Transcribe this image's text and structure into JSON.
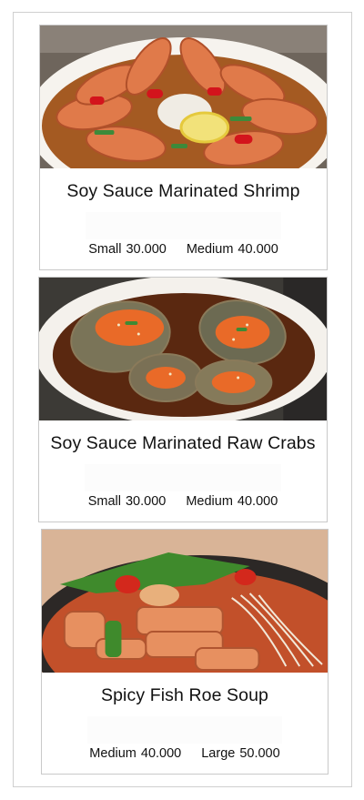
{
  "menu": {
    "items": [
      {
        "title": "Soy Sauce Marinated Shrimp",
        "image_icon": "shrimp-dish-photo",
        "prices": [
          {
            "size": "Small",
            "price": "30.000"
          },
          {
            "size": "Medium",
            "price": "40.000"
          }
        ]
      },
      {
        "title": "Soy Sauce Marinated Raw Crabs",
        "image_icon": "crab-dish-photo",
        "prices": [
          {
            "size": "Small",
            "price": "30.000"
          },
          {
            "size": "Medium",
            "price": "40.000"
          }
        ]
      },
      {
        "title": "Spicy Fish Roe Soup",
        "image_icon": "fish-roe-soup-photo",
        "prices": [
          {
            "size": "Medium",
            "price": "40.000"
          },
          {
            "size": "Large",
            "price": "50.000"
          }
        ]
      }
    ]
  }
}
